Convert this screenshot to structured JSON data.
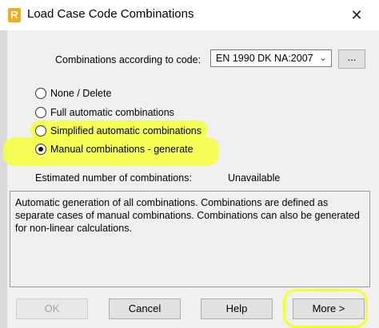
{
  "window": {
    "title": "Load Case Code Combinations",
    "app_icon_letter": "R",
    "close_glyph": "✕"
  },
  "code": {
    "label": "Combinations according to code:",
    "selected": "EN 1990 DK NA:2007",
    "browse_label": "..."
  },
  "options": [
    {
      "label": "None / Delete",
      "checked": false
    },
    {
      "label": "Full automatic combinations",
      "checked": false
    },
    {
      "label": "Simplified automatic combinations",
      "checked": false
    },
    {
      "label": "Manual combinations - generate",
      "checked": true
    }
  ],
  "estimate": {
    "label": "Estimated number of combinations:",
    "value": "Unavailable"
  },
  "description": "Automatic generation of all combinations. Combinations are defined as separate cases of manual combinations. Combinations can also be generated for non-linear calculations.",
  "buttons": {
    "ok": "OK",
    "cancel": "Cancel",
    "help": "Help",
    "more": "More >"
  },
  "colors": {
    "highlight": "#f6ff3c",
    "app_icon": "#f0ad1c"
  }
}
